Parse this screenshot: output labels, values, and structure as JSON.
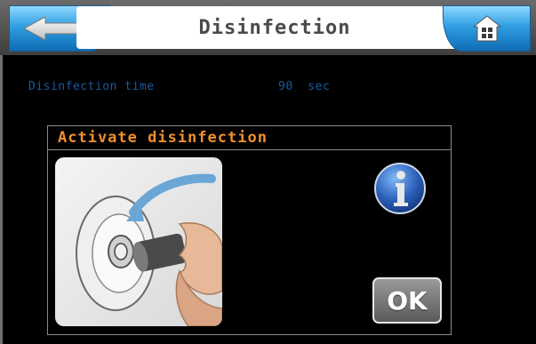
{
  "header": {
    "title": "Disinfection",
    "back_icon": "arrow-left-icon",
    "home_icon": "home-icon"
  },
  "settings": {
    "disinfection_time_label": "Disinfection time",
    "disinfection_time_value": "90  sec"
  },
  "dialog": {
    "title": "Activate disinfection",
    "info_icon": "info-icon",
    "ok_label": "OK"
  },
  "colors": {
    "accent_blue": "#2f9fe3",
    "dialog_title": "#f0902a",
    "info_text": "#1a5a9e"
  }
}
